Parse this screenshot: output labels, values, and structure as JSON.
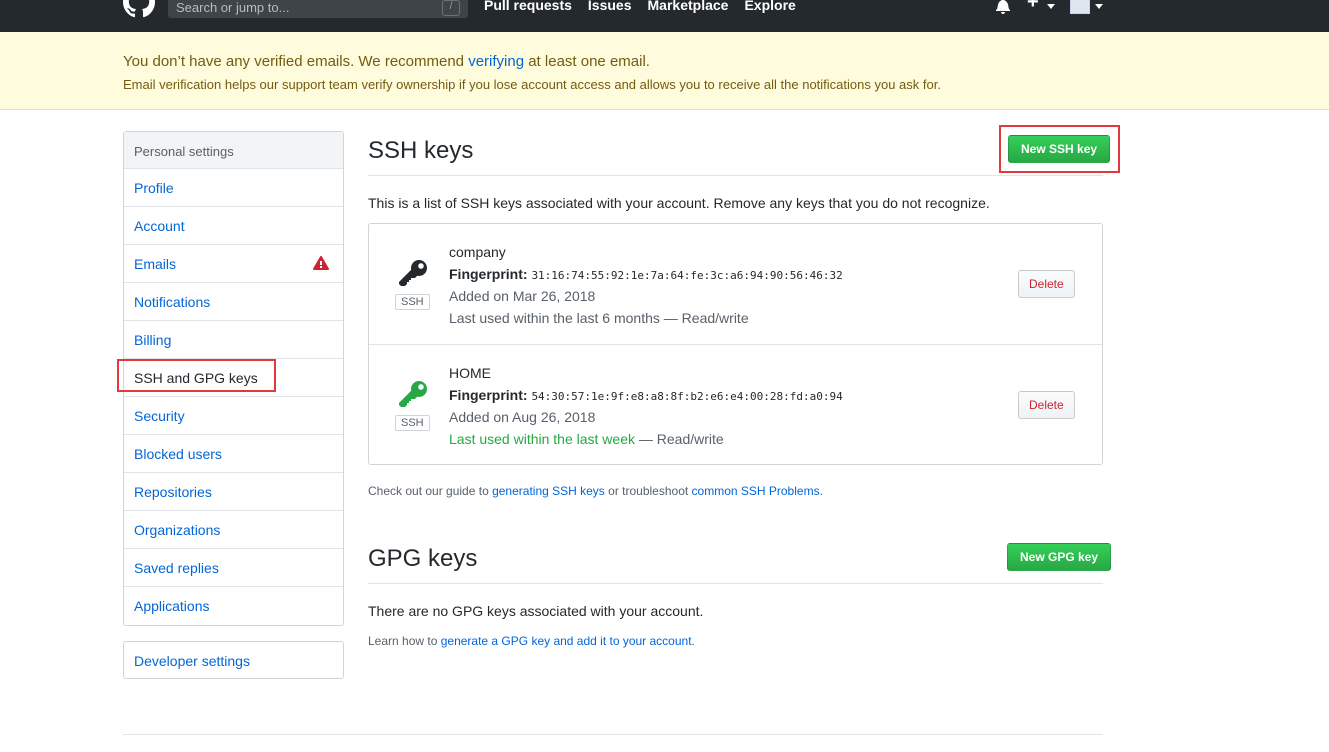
{
  "header": {
    "search_placeholder": "Search or jump to...",
    "search_shortcut": "/",
    "nav": [
      "Pull requests",
      "Issues",
      "Marketplace",
      "Explore"
    ]
  },
  "flash": {
    "title_before": "You don’t have any verified emails. We recommend ",
    "title_link": "verifying",
    "title_after": " at least one email.",
    "subtitle": "Email verification helps our support team verify ownership if you lose account access and allows you to receive all the notifications you ask for."
  },
  "sidebar": {
    "heading": "Personal settings",
    "items": [
      {
        "label": "Profile"
      },
      {
        "label": "Account"
      },
      {
        "label": "Emails"
      },
      {
        "label": "Notifications"
      },
      {
        "label": "Billing"
      },
      {
        "label": "SSH and GPG keys"
      },
      {
        "label": "Security"
      },
      {
        "label": "Blocked users"
      },
      {
        "label": "Repositories"
      },
      {
        "label": "Organizations"
      },
      {
        "label": "Saved replies"
      },
      {
        "label": "Applications"
      }
    ],
    "developer_settings": "Developer settings"
  },
  "ssh": {
    "title": "SSH keys",
    "new_button": "New SSH key",
    "intro": "This is a list of SSH keys associated with your account. Remove any keys that you do not recognize.",
    "keys": [
      {
        "name": "company",
        "fingerprint_label": "Fingerprint:",
        "fingerprint": "31:16:74:55:92:1e:7a:64:fe:3c:a6:94:90:56:46:32",
        "added": "Added on Mar 26, 2018",
        "used_prefix": "Last used within the last 6 months",
        "used_suffix": " — Read/write",
        "badge": "SSH",
        "delete": "Delete",
        "icon_color": "#24292e"
      },
      {
        "name": "HOME",
        "fingerprint_label": "Fingerprint:",
        "fingerprint": "54:30:57:1e:9f:e8:a8:8f:b2:e6:e4:00:28:fd:a0:94",
        "added": "Added on Aug 26, 2018",
        "used_prefix": "Last used within the last week",
        "used_suffix": " — Read/write",
        "badge": "SSH",
        "delete": "Delete",
        "icon_color": "#28a745"
      }
    ],
    "guide_before": "Check out our guide to ",
    "guide_link1": "generating SSH keys",
    "guide_middle": " or troubleshoot ",
    "guide_link2": "common SSH Problems",
    "guide_after": "."
  },
  "gpg": {
    "title": "GPG keys",
    "new_button": "New GPG key",
    "empty": "There are no GPG keys associated with your account.",
    "learn_before": "Learn how to ",
    "learn_link": "generate a GPG key and add it to your account",
    "learn_after": "."
  },
  "colors": {
    "accent": "#0366d6",
    "green": "#28a745",
    "danger": "#cb2431",
    "highlight": "#e0393e"
  }
}
